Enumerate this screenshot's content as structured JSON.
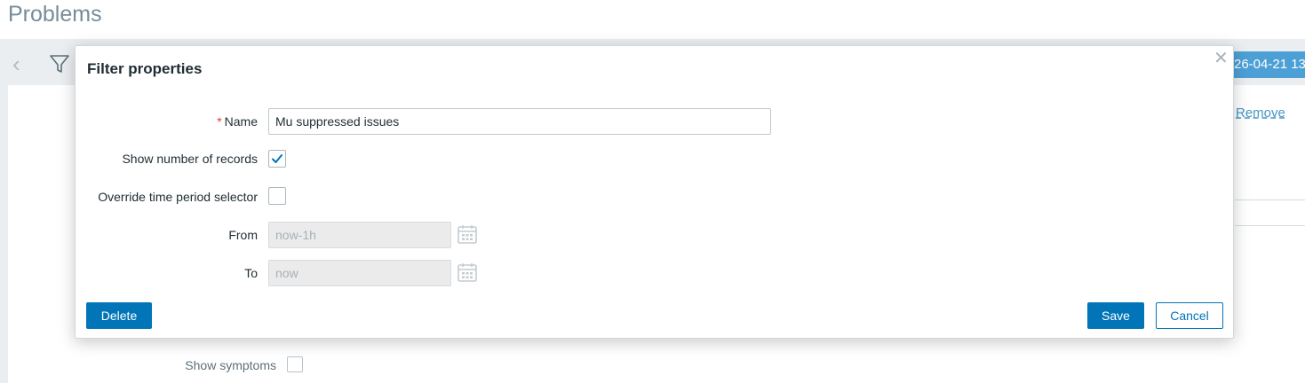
{
  "page": {
    "title": "Problems",
    "time_tab": "26-04-21 13",
    "remove_link": "Remove",
    "show_symptoms_label": "Show symptoms"
  },
  "dialog": {
    "title": "Filter properties",
    "close_icon": "close-icon",
    "fields": {
      "name_label": "Name",
      "name_value": "Mu suppressed issues",
      "show_records_label": "Show number of records",
      "show_records_checked": true,
      "override_label": "Override time period selector",
      "override_checked": false,
      "from_label": "From",
      "from_value": "now-1h",
      "to_label": "To",
      "to_value": "now"
    },
    "buttons": {
      "delete": "Delete",
      "save": "Save",
      "cancel": "Cancel"
    }
  },
  "colors": {
    "accent": "#0275b8",
    "required": "#e33734"
  }
}
